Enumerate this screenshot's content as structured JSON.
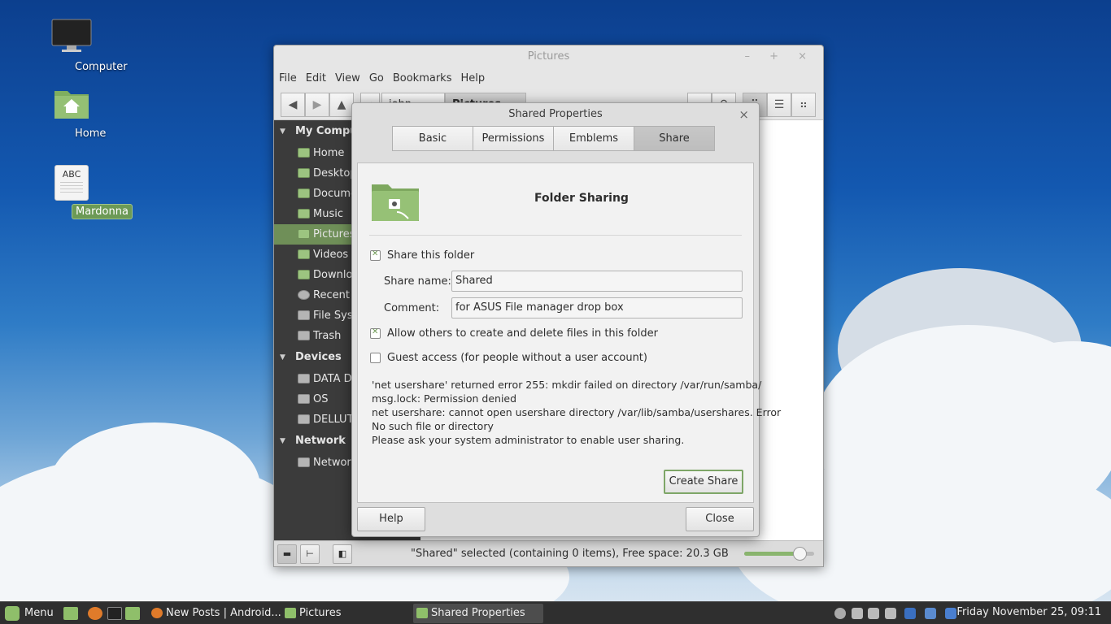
{
  "desktop": {
    "icons": [
      {
        "label": "Computer",
        "icon": "monitor-icon"
      },
      {
        "label": "Home",
        "icon": "home-folder-icon"
      },
      {
        "label": "Mardonna",
        "icon": "text-document-icon",
        "badge_text": "ABC"
      }
    ]
  },
  "nemo": {
    "title": "Pictures",
    "window_controls": "–  +  ×",
    "menu": [
      "File",
      "Edit",
      "View",
      "Go",
      "Bookmarks",
      "Help"
    ],
    "breadcrumbs": [
      "john",
      "Pictures"
    ],
    "sidebar": {
      "sections": [
        {
          "title": "My Computer",
          "items": [
            "Home",
            "Desktop",
            "Documents",
            "Music",
            "Pictures",
            "Videos",
            "Downloads",
            "Recent",
            "File System",
            "Trash"
          ]
        },
        {
          "title": "Devices",
          "items": [
            "DATA Drive",
            "OS",
            "DELLUTILITY"
          ]
        },
        {
          "title": "Network",
          "items": [
            "Network"
          ]
        }
      ],
      "selected": "Pictures"
    },
    "status_text": "\"Shared\" selected (containing 0 items), Free space: 20.3 GB",
    "zoom_level": 0.8
  },
  "dialog": {
    "title": "Shared Properties",
    "tabs": [
      "Basic",
      "Permissions",
      "Emblems",
      "Share"
    ],
    "selected_tab": "Share",
    "heading": "Folder Sharing",
    "share_this_folder": {
      "label": "Share this folder",
      "checked": true
    },
    "share_name": {
      "label": "Share name:",
      "value": "Shared"
    },
    "comment": {
      "label": "Comment:",
      "value": "for ASUS File manager drop box"
    },
    "allow_others": {
      "label": "Allow others to create and delete files in this folder",
      "checked": true
    },
    "guest_access": {
      "label": "Guest access (for people without a user account)",
      "checked": false
    },
    "error_lines": [
      "'net usershare' returned error 255: mkdir failed on directory /var/run/samba/",
      "msg.lock: Permission denied",
      "net usershare: cannot open usershare directory /var/lib/samba/usershares. Error",
      "No such file or directory",
      "Please ask your system administrator to enable user sharing."
    ],
    "create_share_label": "Create Share",
    "help_label": "Help",
    "close_label": "Close"
  },
  "taskbar": {
    "menu_label": "Menu",
    "tasks": [
      "New Posts | Android...",
      "Pictures",
      "Shared Properties"
    ],
    "active_task": "Shared Properties",
    "clock": "Friday November 25, 09:11"
  },
  "colors": {
    "accent_green": "#8fbf6a",
    "sidebar_selected": "#6f8f58",
    "sidebar_bg": "#3b3b3b",
    "taskbar_bg": "#2f2f2f"
  }
}
